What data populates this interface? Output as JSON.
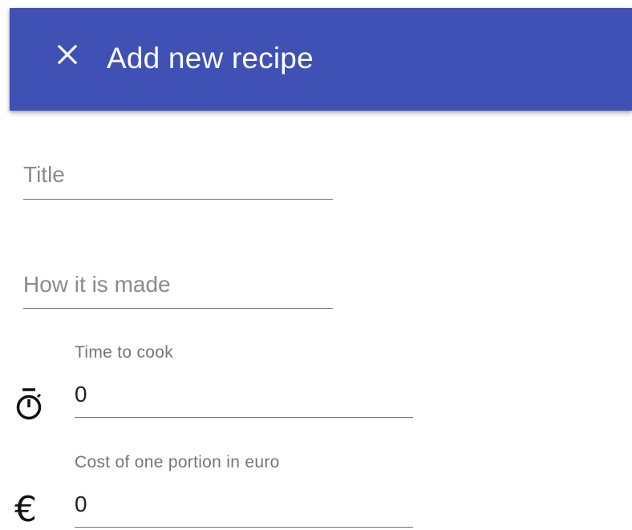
{
  "toolbar": {
    "title": "Add new recipe",
    "close_icon": "close-icon",
    "color": "#3f51b5"
  },
  "form": {
    "title_field": {
      "placeholder": "Title",
      "value": ""
    },
    "method_field": {
      "placeholder": "How it is made",
      "value": ""
    },
    "time_field": {
      "label": "Time to cook",
      "value": "0",
      "icon": "timer-icon"
    },
    "cost_field": {
      "label": "Cost of one portion in euro",
      "value": "0",
      "icon": "euro-icon",
      "icon_glyph": "€"
    }
  }
}
